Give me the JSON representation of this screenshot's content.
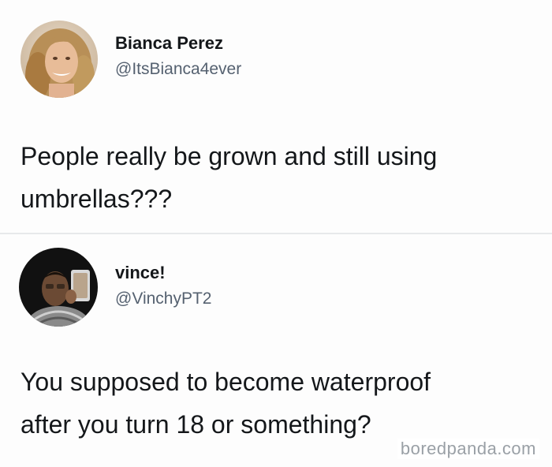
{
  "tweets": [
    {
      "display_name": "Bianca Perez",
      "handle": "@ItsBianca4ever",
      "text_lines": [
        "People really be grown and still using",
        "umbrellas???"
      ]
    },
    {
      "display_name": "vince!",
      "handle": "@VinchyPT2",
      "text_lines": [
        "You supposed to become waterproof",
        "after you turn 18 or something?"
      ]
    }
  ],
  "watermark": "boredpanda.com",
  "colors": {
    "text": "#14171a",
    "handle": "#556170",
    "separator": "#e7e9eb",
    "watermark": "#9aa0a6"
  }
}
